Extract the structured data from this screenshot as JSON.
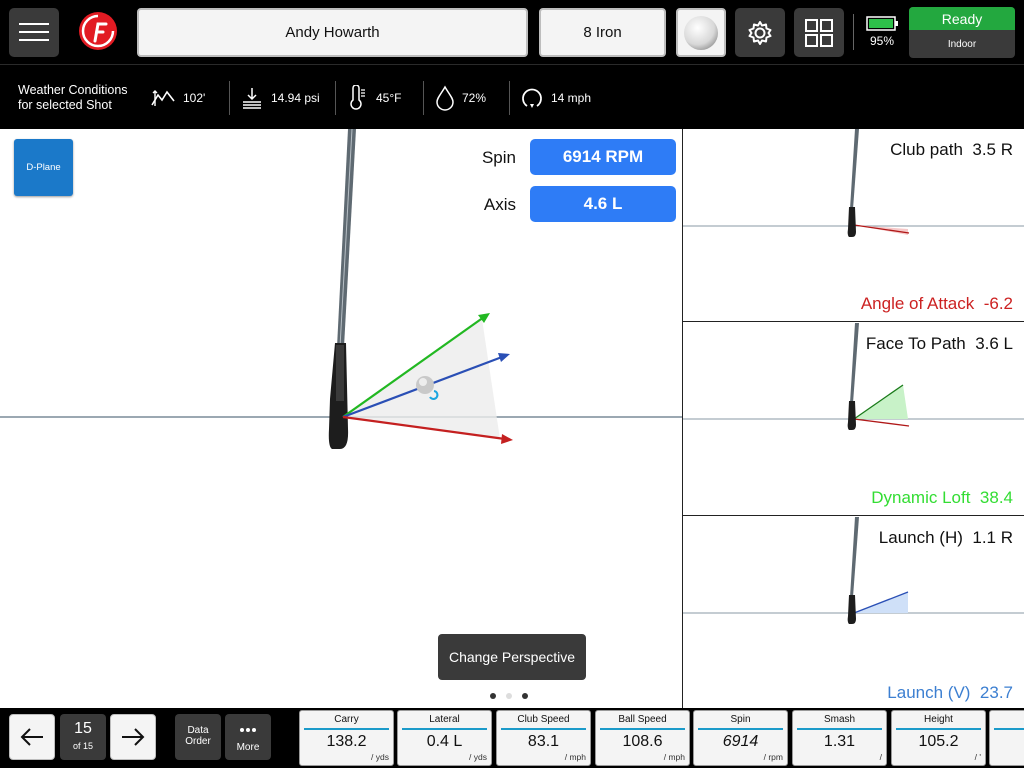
{
  "header": {
    "player_name": "Andy Howarth",
    "club": "8 Iron",
    "battery_percent": "95%",
    "status": "Ready",
    "mode": "Indoor",
    "colors": {
      "status_green": "#23a83f",
      "button_dark": "#3a3a3a",
      "logo_red": "#e21b23"
    }
  },
  "weather": {
    "title_line1": "Weather Conditions",
    "title_line2": "for selected Shot",
    "altitude": "102'",
    "pressure": "14.94 psi",
    "temperature": "45°F",
    "humidity": "72%",
    "wind": "14 mph"
  },
  "main": {
    "dplane_label": "D-Plane",
    "spin_label": "Spin",
    "spin_value": "6914 RPM",
    "axis_label": "Axis",
    "axis_value": "4.6 L",
    "perspective_button": "Change Perspective",
    "page_dots": 3,
    "active_dot": 2,
    "colors": {
      "pill_blue": "#2e7cf6",
      "dplane_blue": "#1b79c9"
    }
  },
  "panels": [
    {
      "top_label": "Club path",
      "top_value": "3.5 R",
      "bottom_label": "Angle of Attack",
      "bottom_value": "-6.2",
      "bottom_color": "#cc2222"
    },
    {
      "top_label": "Face To Path",
      "top_value": "3.6 L",
      "bottom_label": "Dynamic Loft",
      "bottom_value": "38.4",
      "bottom_color": "#33dd33"
    },
    {
      "top_label": "Launch (H)",
      "top_value": "1.1 R",
      "bottom_label": "Launch (V)",
      "bottom_value": "23.7",
      "bottom_color": "#3c7fd1"
    }
  ],
  "bottom": {
    "shot_number": "15",
    "shot_of": "of 15",
    "data_order_line1": "Data",
    "data_order_line2": "Order",
    "more_label": "More",
    "tiles": [
      {
        "label": "Carry",
        "value": "138.2",
        "unit": "/ yds"
      },
      {
        "label": "Lateral",
        "value": "0.4 L",
        "unit": "/ yds"
      },
      {
        "label": "Club Speed",
        "value": "83.1",
        "unit": "/ mph"
      },
      {
        "label": "Ball Speed",
        "value": "108.6",
        "unit": "/ mph"
      },
      {
        "label": "Spin",
        "value": "6914",
        "unit": "/ rpm",
        "italic": true
      },
      {
        "label": "Smash",
        "value": "1.31",
        "unit": "/"
      },
      {
        "label": "Height",
        "value": "105.2",
        "unit": "/ '"
      },
      {
        "label": "",
        "value": "",
        "unit": ""
      }
    ]
  }
}
